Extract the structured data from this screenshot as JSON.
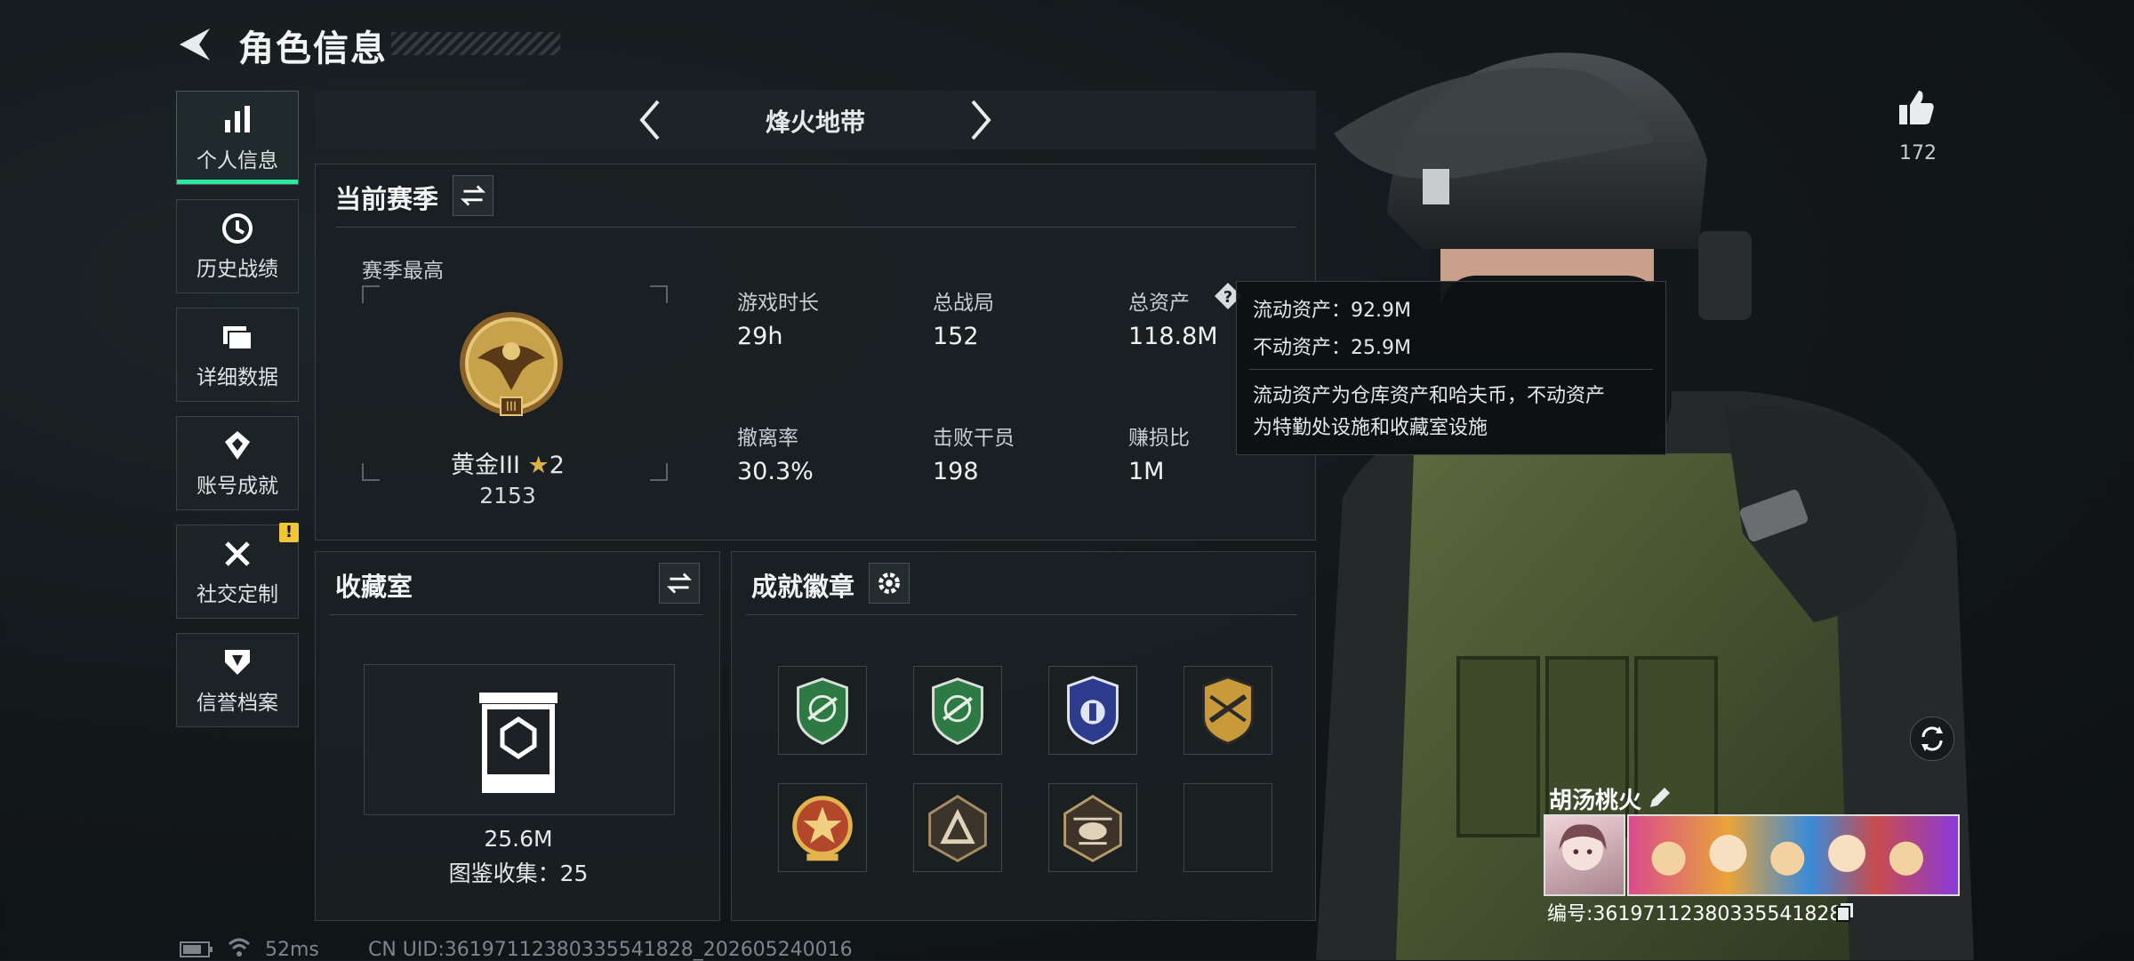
{
  "header": {
    "title": "角色信息"
  },
  "sidebar": {
    "items": [
      {
        "label": "个人信息",
        "icon": "bar-chart-icon",
        "active": true
      },
      {
        "label": "历史战绩",
        "icon": "history-clock-icon"
      },
      {
        "label": "详细数据",
        "icon": "folders-icon"
      },
      {
        "label": "账号成就",
        "icon": "achievement-icon"
      },
      {
        "label": "社交定制",
        "icon": "tools-icon",
        "badge": "!"
      },
      {
        "label": "信誉档案",
        "icon": "reputation-icon"
      }
    ]
  },
  "mode": {
    "label": "烽火地带"
  },
  "season": {
    "title": "当前赛季",
    "best_label": "赛季最高",
    "rank_name": "黄金III",
    "rank_stars": "2",
    "rank_points": "2153",
    "stats": [
      {
        "label": "游戏时长",
        "value": "29h"
      },
      {
        "label": "总战局",
        "value": "152"
      },
      {
        "label": "总资产",
        "value": "118.8M"
      },
      {
        "label": "撤离率",
        "value": "30.3%"
      },
      {
        "label": "击败干员",
        "value": "198"
      },
      {
        "label": "赚损比",
        "value": "1M"
      }
    ]
  },
  "tooltip": {
    "line1": "流动资产：92.9M",
    "line2": "不动资产：25.9M",
    "desc1": "流动资产为仓库资产和哈夫币，不动资产",
    "desc2": "为特勤处设施和收藏室设施"
  },
  "collection": {
    "title": "收藏室",
    "value": "25.6M",
    "count_text": "图鉴收集：25"
  },
  "badges": {
    "title": "成就徽章"
  },
  "player": {
    "likes": "172",
    "name": "胡汤桃火",
    "id_text": "编号:3619711238033554182​8"
  },
  "footer": {
    "ping": "52ms",
    "uid": "CN UID:361971123803355418​28_202605240016"
  },
  "colors": {
    "accent": "#2ee8a0",
    "warning": "#f2c438",
    "gold": "#c8a24a"
  }
}
